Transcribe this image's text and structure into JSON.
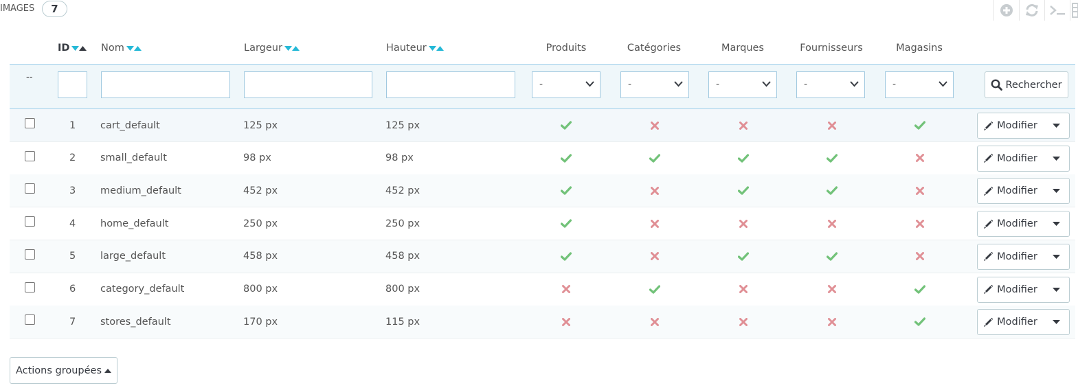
{
  "panel": {
    "title": "IMAGES",
    "count": "7"
  },
  "toolbar": {
    "icons": [
      "add-icon",
      "refresh-icon",
      "sql-terminal-icon",
      "export-icon"
    ]
  },
  "columns": {
    "id": "ID",
    "nom": "Nom",
    "largeur": "Largeur",
    "hauteur": "Hauteur",
    "produits": "Produits",
    "categories": "Catégories",
    "marques": "Marques",
    "fournisseurs": "Fournisseurs",
    "magasins": "Magasins"
  },
  "filters": {
    "bulk_placeholder": "--",
    "select_value": "-",
    "search_label": "Rechercher"
  },
  "rows": [
    {
      "id": "1",
      "name": "cart_default",
      "width": "125 px",
      "height": "125 px",
      "produits": true,
      "categories": false,
      "marques": false,
      "fournisseurs": false,
      "magasins": true
    },
    {
      "id": "2",
      "name": "small_default",
      "width": "98 px",
      "height": "98 px",
      "produits": true,
      "categories": true,
      "marques": true,
      "fournisseurs": true,
      "magasins": false
    },
    {
      "id": "3",
      "name": "medium_default",
      "width": "452 px",
      "height": "452 px",
      "produits": true,
      "categories": false,
      "marques": true,
      "fournisseurs": true,
      "magasins": false
    },
    {
      "id": "4",
      "name": "home_default",
      "width": "250 px",
      "height": "250 px",
      "produits": true,
      "categories": false,
      "marques": false,
      "fournisseurs": false,
      "magasins": false
    },
    {
      "id": "5",
      "name": "large_default",
      "width": "458 px",
      "height": "458 px",
      "produits": true,
      "categories": false,
      "marques": true,
      "fournisseurs": true,
      "magasins": false
    },
    {
      "id": "6",
      "name": "category_default",
      "width": "800 px",
      "height": "800 px",
      "produits": false,
      "categories": true,
      "marques": false,
      "fournisseurs": false,
      "magasins": true
    },
    {
      "id": "7",
      "name": "stores_default",
      "width": "170 px",
      "height": "115 px",
      "produits": false,
      "categories": false,
      "marques": false,
      "fournisseurs": false,
      "magasins": true
    }
  ],
  "row_actions": {
    "edit_label": "Modifier"
  },
  "bulk": {
    "label": "Actions groupées"
  },
  "colors": {
    "check": "#72c279",
    "cross": "#e08f95",
    "sort_active": "#25b9d7",
    "filter_bg": "#eff7fa"
  }
}
